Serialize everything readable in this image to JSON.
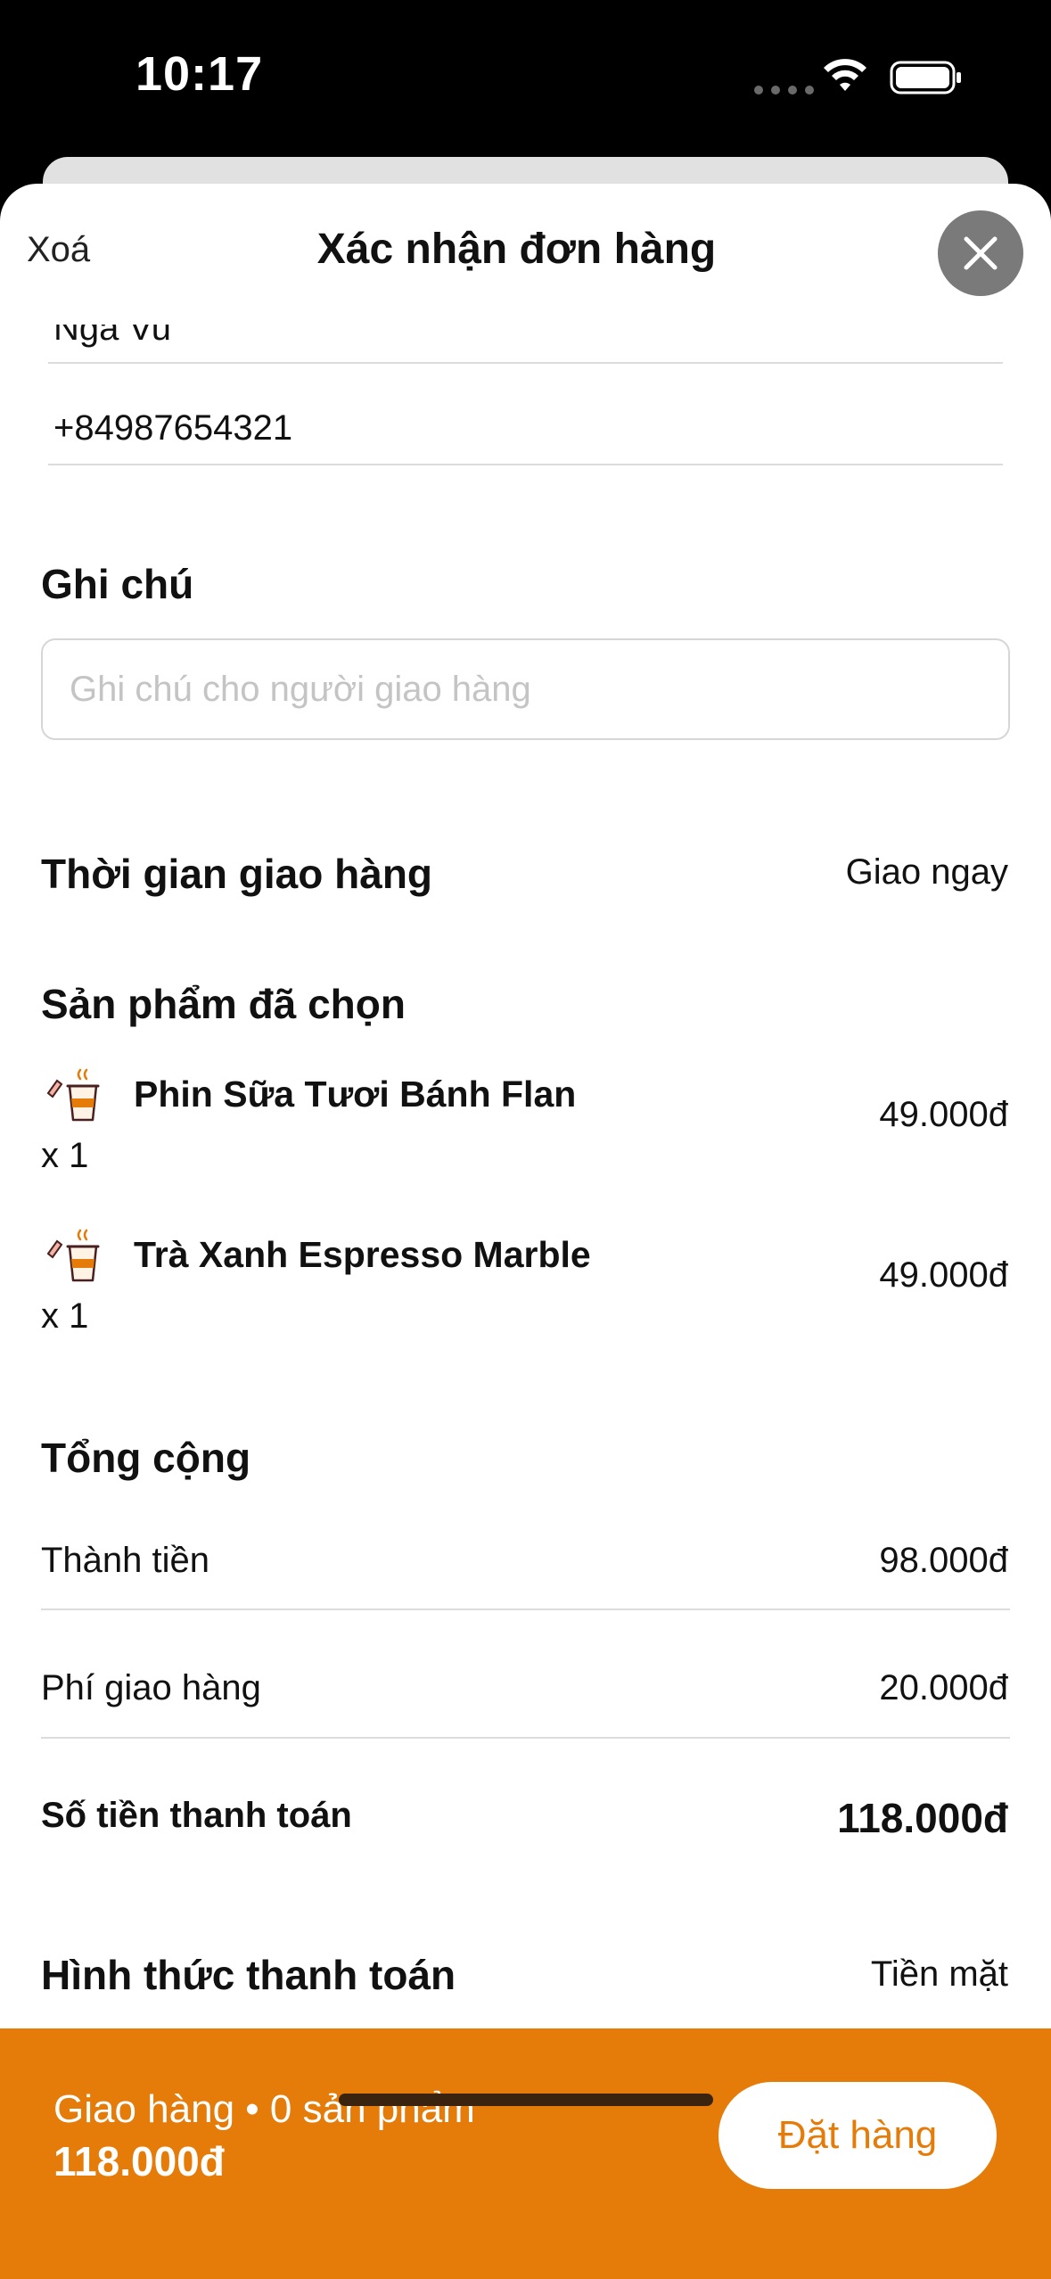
{
  "status_bar": {
    "time": "10:17"
  },
  "header": {
    "clear_label": "Xoá",
    "title": "Xác nhận đơn hàng"
  },
  "contact": {
    "name": "Nga Vu",
    "phone": "+84987654321"
  },
  "note": {
    "title": "Ghi chú",
    "placeholder": "Ghi chú cho người giao hàng",
    "value": ""
  },
  "delivery_time": {
    "label": "Thời gian giao hàng",
    "value": "Giao ngay"
  },
  "products": {
    "title": "Sản phẩm đã chọn",
    "items": [
      {
        "name": "Phin Sữa Tươi Bánh Flan",
        "quantity": "x 1",
        "price": "49.000đ",
        "icon": "coffee-cup-icon"
      },
      {
        "name": "Trà Xanh Espresso Marble",
        "quantity": "x 1",
        "price": "49.000đ",
        "icon": "coffee-cup-icon"
      }
    ]
  },
  "totals": {
    "title": "Tổng cộng",
    "subtotal_label": "Thành tiền",
    "subtotal_value": "98.000đ",
    "shipping_label": "Phí giao hàng",
    "shipping_value": "20.000đ",
    "payable_label": "Số tiền thanh toán",
    "payable_value": "118.000đ"
  },
  "payment": {
    "label": "Hình thức thanh toán",
    "value": "Tiền mặt"
  },
  "bottom_bar": {
    "summary": "Giao hàng • 0 sản phẩm",
    "total": "118.000đ",
    "order_button": "Đặt hàng"
  },
  "colors": {
    "accent": "#e57c09",
    "close_button": "#7a7a7a"
  }
}
